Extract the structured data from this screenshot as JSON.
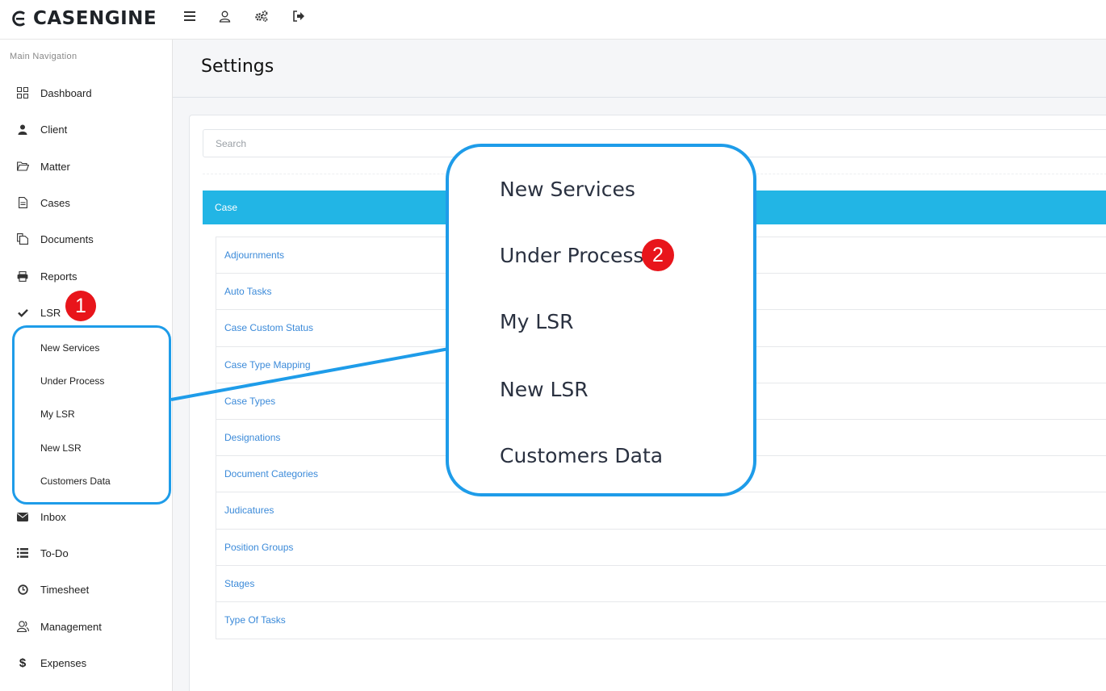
{
  "app": {
    "logo_text": "CASENGINE"
  },
  "topbar": {
    "icons": [
      "menu-icon",
      "user-icon",
      "gears-icon",
      "logout-icon"
    ]
  },
  "sidebar": {
    "header": "Main Navigation",
    "items": [
      {
        "label": "Dashboard",
        "icon": "dashboard-icon"
      },
      {
        "label": "Client",
        "icon": "user-icon"
      },
      {
        "label": "Matter",
        "icon": "folder-open-icon"
      },
      {
        "label": "Cases",
        "icon": "file-icon"
      },
      {
        "label": "Documents",
        "icon": "copy-icon"
      },
      {
        "label": "Reports",
        "icon": "print-icon"
      },
      {
        "label": "LSR",
        "icon": "check-icon"
      },
      {
        "label": "Inbox",
        "icon": "envelope-icon"
      },
      {
        "label": "To-Do",
        "icon": "list-icon"
      },
      {
        "label": "Timesheet",
        "icon": "clock-icon"
      },
      {
        "label": "Management",
        "icon": "users-icon"
      },
      {
        "label": "Expenses",
        "icon": "dollar-icon"
      }
    ],
    "lsr_subitems": [
      "New Services",
      "Under Process",
      "My LSR",
      "New LSR",
      "Customers Data"
    ]
  },
  "annotations": {
    "badge1": "1",
    "badge2": "2",
    "zoom_items": [
      "New Services",
      "Under Process",
      "My LSR",
      "New LSR",
      "Customers Data"
    ],
    "accent_color": "#1e9ce9",
    "badge_color": "#e8151b"
  },
  "main": {
    "title": "Settings",
    "search_placeholder": "Search",
    "panel_title": "Case",
    "panel_color": "#22b5e5",
    "list": [
      "Adjournments",
      "Auto Tasks",
      "Case Custom Status",
      "Case Type Mapping",
      "Case Types",
      "Designations",
      "Document Categories",
      "Judicatures",
      "Position Groups",
      "Stages",
      "Type Of Tasks"
    ]
  }
}
